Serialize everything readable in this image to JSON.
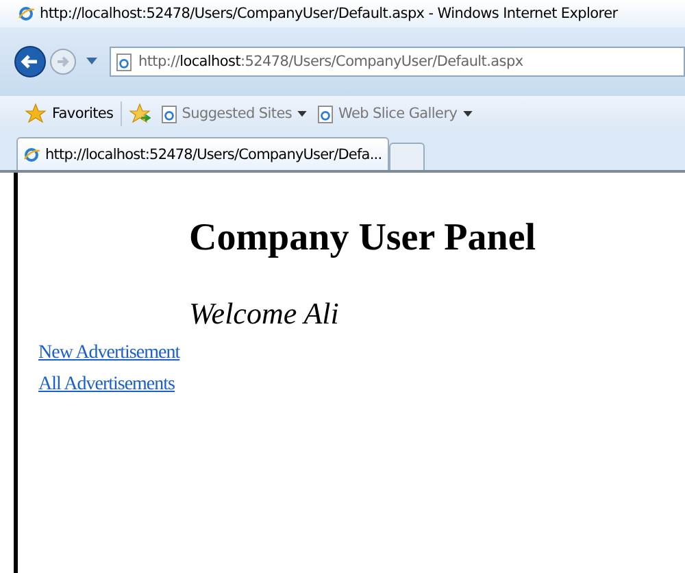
{
  "window": {
    "title": "http://localhost:52478/Users/CompanyUser/Default.aspx - Windows Internet Explorer"
  },
  "address_bar": {
    "prefix": "http://",
    "host": "localhost",
    "rest": ":52478/Users/CompanyUser/Default.aspx"
  },
  "favorites_bar": {
    "favorites": "Favorites",
    "links": [
      {
        "label": "Suggested Sites",
        "dropdown": true
      },
      {
        "label": "Web Slice Gallery",
        "dropdown": true
      }
    ]
  },
  "tabs": [
    {
      "label": "http://localhost:52478/Users/CompanyUser/Defa...",
      "selected": true
    }
  ],
  "page": {
    "heading": "Company User Panel",
    "welcome": "Welcome Ali",
    "links": [
      "New Advertisement",
      "All Advertisements"
    ]
  }
}
